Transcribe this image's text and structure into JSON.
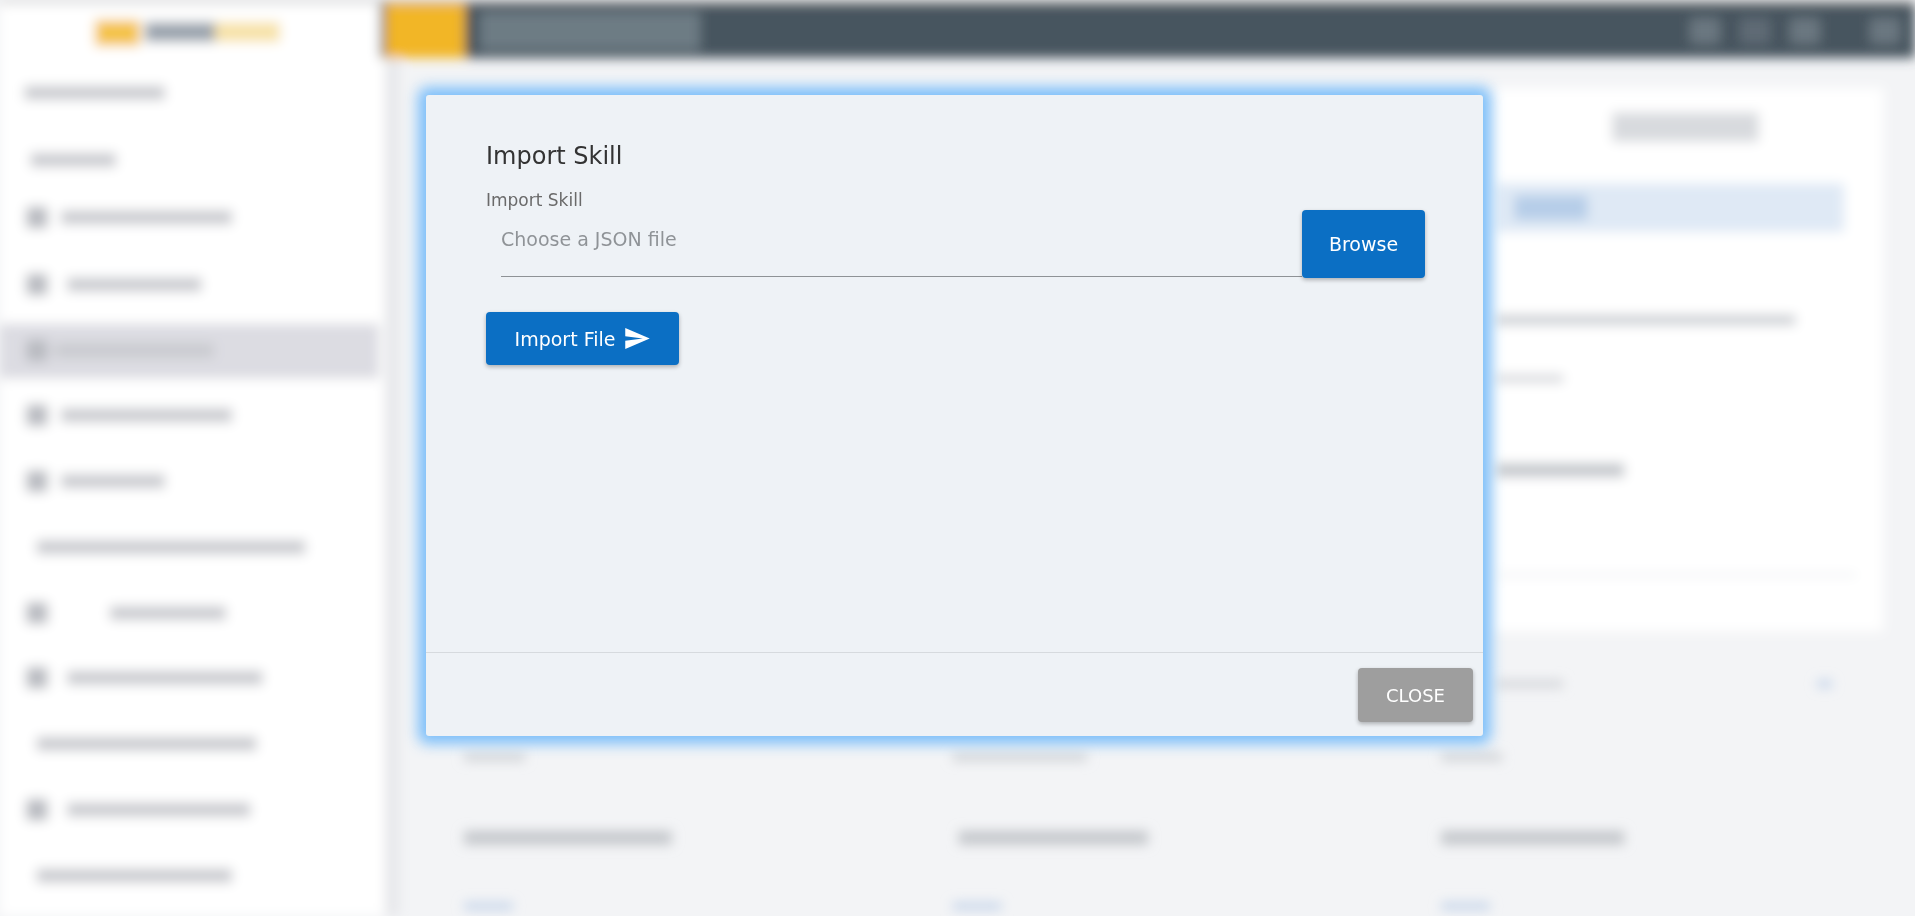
{
  "dialog": {
    "title": "Import Skill",
    "field": {
      "label": "Import Skill",
      "placeholder": "Choose a JSON file"
    },
    "browse_button": "Browse",
    "import_button": "Import File",
    "close_button": "CLOSE"
  }
}
